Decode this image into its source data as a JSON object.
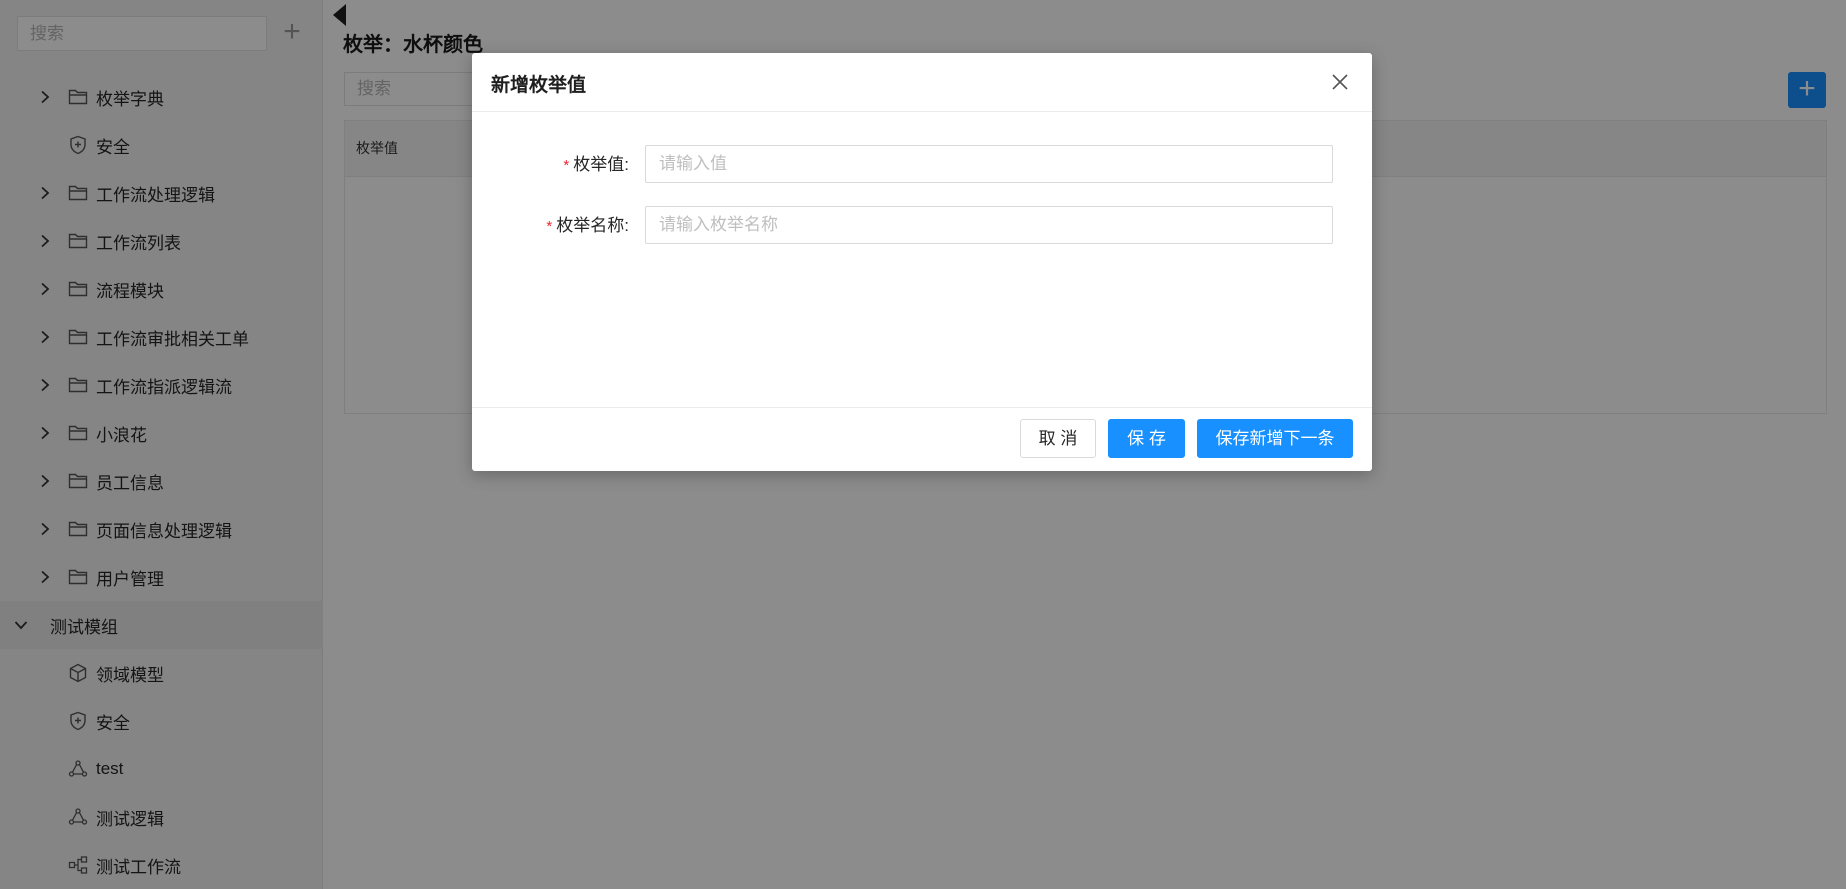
{
  "sidebar": {
    "search_placeholder": "搜索",
    "add_icon": "plus-icon",
    "items": [
      {
        "label": "枚举字典",
        "icon": "folder-icon",
        "expandable": true
      },
      {
        "label": "安全",
        "icon": "shield-icon",
        "expandable": false
      },
      {
        "label": "工作流处理逻辑",
        "icon": "folder-icon",
        "expandable": true
      },
      {
        "label": "工作流列表",
        "icon": "folder-icon",
        "expandable": true
      },
      {
        "label": "流程模块",
        "icon": "folder-icon",
        "expandable": true
      },
      {
        "label": "工作流审批相关工单",
        "icon": "folder-icon",
        "expandable": true
      },
      {
        "label": "工作流指派逻辑流",
        "icon": "folder-icon",
        "expandable": true
      },
      {
        "label": "小浪花",
        "icon": "folder-icon",
        "expandable": true
      },
      {
        "label": "员工信息",
        "icon": "folder-icon",
        "expandable": true
      },
      {
        "label": "页面信息处理逻辑",
        "icon": "folder-icon",
        "expandable": true
      },
      {
        "label": "用户管理",
        "icon": "folder-icon",
        "expandable": true
      },
      {
        "label": "测试模组",
        "icon": "chevron-down-icon",
        "expandable": true,
        "expanded": true,
        "selected": true
      },
      {
        "label": "领域模型",
        "icon": "cube-icon",
        "expandable": false
      },
      {
        "label": "安全",
        "icon": "shield-icon",
        "expandable": false
      },
      {
        "label": "test",
        "icon": "flow-icon",
        "expandable": false
      },
      {
        "label": "测试逻辑",
        "icon": "flow-icon",
        "expandable": false
      },
      {
        "label": "测试工作流",
        "icon": "workflow-icon",
        "expandable": false
      }
    ]
  },
  "main": {
    "title": "枚举：水杯颜色",
    "search_placeholder": "搜索",
    "table": {
      "columns": [
        "枚举值"
      ]
    }
  },
  "modal": {
    "title": "新增枚举值",
    "fields": [
      {
        "label": "枚举值:",
        "placeholder": "请输入值",
        "required": true
      },
      {
        "label": "枚举名称:",
        "placeholder": "请输入枚举名称",
        "required": true
      }
    ],
    "buttons": {
      "cancel": "取 消",
      "save": "保 存",
      "save_next": "保存新增下一条"
    }
  },
  "colors": {
    "primary": "#1890ff",
    "required": "#f5222d",
    "overlay": "rgba(0,0,0,0.45)"
  }
}
